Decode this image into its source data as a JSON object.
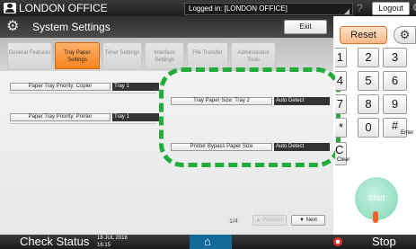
{
  "topbar": {
    "office_title": "LONDON OFFICE",
    "login_status": "Logged in: [LONDON OFFICE]",
    "help_glyph": "?",
    "logout_label": "Logout",
    "icons": {
      "user": "user-icon",
      "help": "help-icon",
      "moon": "moon-icon"
    }
  },
  "window": {
    "title": "System Settings",
    "exit_label": "Exit",
    "tabs": [
      {
        "label": "General Features",
        "active": false
      },
      {
        "label": "Tray Paper Settings",
        "active": true
      },
      {
        "label": "Timer Settings",
        "active": false
      },
      {
        "label": "Interface Settings",
        "active": false
      },
      {
        "label": "File Transfer",
        "active": false
      },
      {
        "label": "Administrator Tools",
        "active": false
      }
    ],
    "rows": [
      {
        "label": "Paper Tray Priority: Copier",
        "value": "Tray 1"
      },
      {
        "label": "Paper Tray Priority: Printer",
        "value": "Tray 1"
      },
      {
        "label": "Tray Paper Size: Tray 2",
        "value": "Auto Detect"
      },
      {
        "label": "Printer Bypass Paper Size",
        "value": "Auto Detect"
      }
    ],
    "pager": {
      "indicator": "1/4",
      "prev_label": "Previous",
      "next_label": "Next"
    }
  },
  "keypad": {
    "reset_label": "Reset",
    "keys": [
      "1",
      "2",
      "3",
      "4",
      "5",
      "6",
      "7",
      "8",
      "9",
      "*",
      "0",
      "#",
      "C"
    ],
    "enter_label": "Enter",
    "clear_label": "Clear",
    "start_label": "Start"
  },
  "bottombar": {
    "check_status_label": "Check Status",
    "date": "18 JUL 2018",
    "time": "16:15",
    "stop_label": "Stop"
  },
  "colors": {
    "active_tab": "#f6821f",
    "highlight": "#22ac3a",
    "home_button": "#146b9a",
    "stop_icon": "#e03426",
    "start_button": "#7fd8b6"
  }
}
